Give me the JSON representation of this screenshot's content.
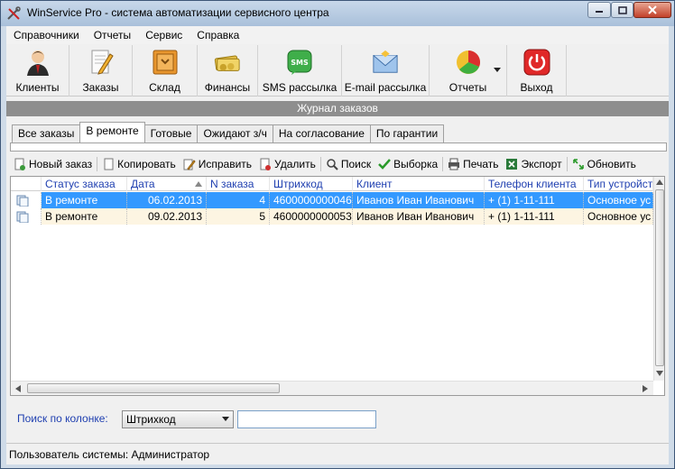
{
  "window": {
    "title": "WinService Pro - система автоматизации сервисного центра"
  },
  "menu": [
    "Справочники",
    "Отчеты",
    "Сервис",
    "Справка"
  ],
  "toolbar": [
    {
      "label": "Клиенты",
      "icon": "user-icon"
    },
    {
      "label": "Заказы",
      "icon": "document-pencil-icon"
    },
    {
      "label": "Склад",
      "icon": "warehouse-box-icon"
    },
    {
      "label": "Финансы",
      "icon": "money-icon"
    },
    {
      "label": "SMS рассылка",
      "icon": "sms-icon",
      "icon_text": "SMS"
    },
    {
      "label": "E-mail рассылка",
      "icon": "envelope-icon"
    },
    {
      "label": "Отчеты",
      "icon": "pie-chart-icon"
    },
    {
      "label": "Выход",
      "icon": "power-icon"
    }
  ],
  "journal": {
    "header": "Журнал заказов"
  },
  "tabs": [
    "Все заказы",
    "В ремонте",
    "Готовые",
    "Ожидают з/ч",
    "На согласование",
    "По гарантии"
  ],
  "active_tab": "В ремонте",
  "actions": [
    {
      "label": "Новый заказ",
      "icon": "new-icon"
    },
    {
      "label": "Копировать",
      "icon": "copy-icon"
    },
    {
      "label": "Исправить",
      "icon": "edit-icon"
    },
    {
      "label": "Удалить",
      "icon": "delete-icon"
    },
    {
      "label": "Поиск",
      "icon": "search-icon"
    },
    {
      "label": "Выборка",
      "icon": "checkmark-icon"
    },
    {
      "label": "Печать",
      "icon": "printer-icon"
    },
    {
      "label": "Экспорт",
      "icon": "excel-icon"
    },
    {
      "label": "Обновить",
      "icon": "refresh-icon"
    }
  ],
  "table": {
    "columns": [
      "Статус заказа",
      "Дата",
      "N заказа",
      "Штрихкод",
      "Клиент",
      "Телефон клиента",
      "Тип устройст"
    ],
    "rows": [
      [
        "В ремонте",
        "06.02.2013",
        "4",
        "4600000000046",
        "Иванов Иван Иванович",
        "+ (1) 1-11-111",
        "Основное ус"
      ],
      [
        "В ремонте",
        "09.02.2013",
        "5",
        "4600000000053",
        "Иванов Иван Иванович",
        "+ (1) 1-11-111",
        "Основное ус"
      ]
    ],
    "selected_row": 0
  },
  "search": {
    "label": "Поиск по колонке:",
    "column": "Штрихкод",
    "value": ""
  },
  "status": {
    "text": "Пользователь системы: Администратор"
  },
  "colors": {
    "selection": "#3399ff",
    "header_text": "#1f3fb0",
    "alt_row": "#fdf5e2"
  }
}
